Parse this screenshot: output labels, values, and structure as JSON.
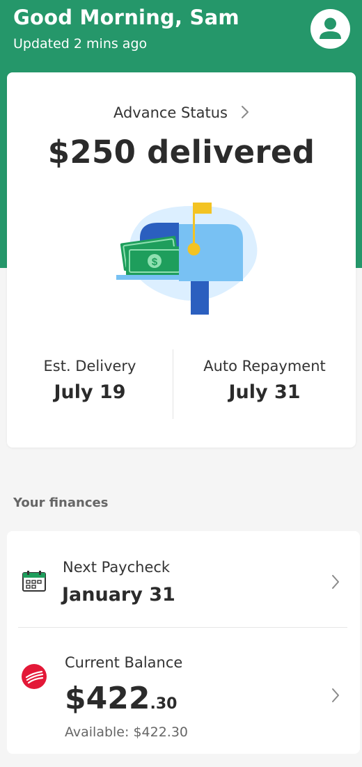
{
  "header": {
    "greeting": "Good Morning, Sam",
    "updated": "Updated 2 mins ago",
    "avatar_icon": "user-avatar-icon"
  },
  "advance": {
    "status_label": "Advance Status",
    "amount_title": "$250 delivered",
    "est_delivery_label": "Est. Delivery",
    "est_delivery_date": "July 19",
    "auto_repayment_label": "Auto Repayment",
    "auto_repayment_date": "July 31"
  },
  "finances": {
    "section_label": "Your finances",
    "items": [
      {
        "title": "Next Paycheck",
        "value": "January 31",
        "icon": "calendar-icon"
      },
      {
        "title": "Current Balance",
        "value_whole": "$422",
        "value_cents": ".30",
        "available": "Available: $422.30",
        "icon": "bank-logo-icon"
      }
    ]
  },
  "colors": {
    "brand_green": "#25976a",
    "mailbox_blue": "#78c1f3",
    "cash_green": "#1e9e5c",
    "flag_yellow": "#f3c323",
    "bank_red": "#e31837"
  }
}
